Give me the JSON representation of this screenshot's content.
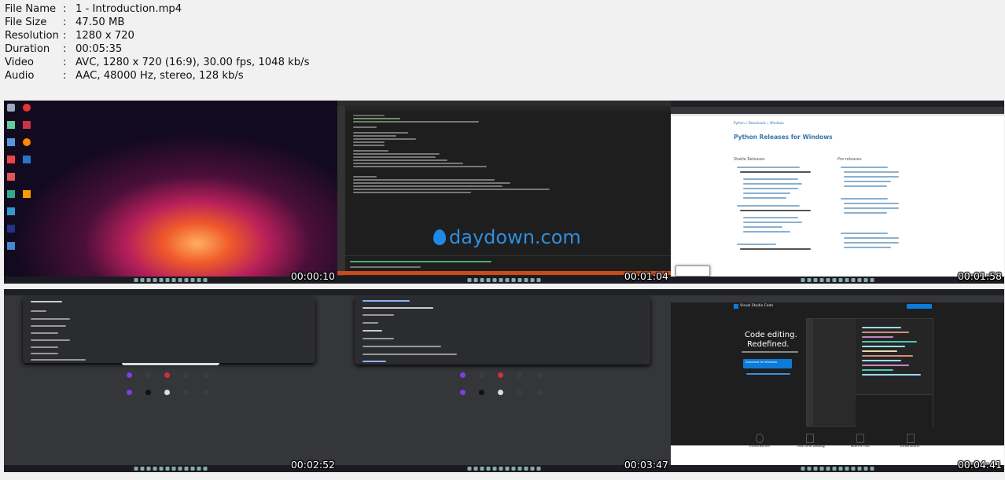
{
  "file_info": [
    {
      "key": "File Name",
      "value": "1 - Introduction.mp4"
    },
    {
      "key": "File Size",
      "value": "47.50 MB"
    },
    {
      "key": "Resolution",
      "value": "1280 x 720"
    },
    {
      "key": "Duration",
      "value": "00:05:35"
    },
    {
      "key": "Video",
      "value": "AVC, 1280 x 720 (16:9), 30.00 fps, 1048 kb/s"
    },
    {
      "key": "Audio",
      "value": "AAC, 48000 Hz, stereo, 128 kb/s"
    }
  ],
  "separator": ":",
  "thumbnails": [
    {
      "timestamp": "00:00:10"
    },
    {
      "timestamp": "00:01:04",
      "watermark": "daydown.com"
    },
    {
      "timestamp": "00:01:58",
      "page_title": "Python Releases for Windows",
      "col1": "Stable Releases",
      "col2": "Pre-releases"
    },
    {
      "timestamp": "00:02:52"
    },
    {
      "timestamp": "00:03:47"
    },
    {
      "timestamp": "00:04:41",
      "headline1": "Code editing.",
      "headline2": "Redefined.",
      "button": "Download for Windows",
      "features": [
        "IntelliSense",
        "Run and Debug",
        "Built-in Git",
        "Extensions"
      ],
      "brand": "Visual Studio Code"
    }
  ],
  "colors": {
    "accent_blue": "#0e7bd8",
    "python_blue": "#3775a9"
  }
}
